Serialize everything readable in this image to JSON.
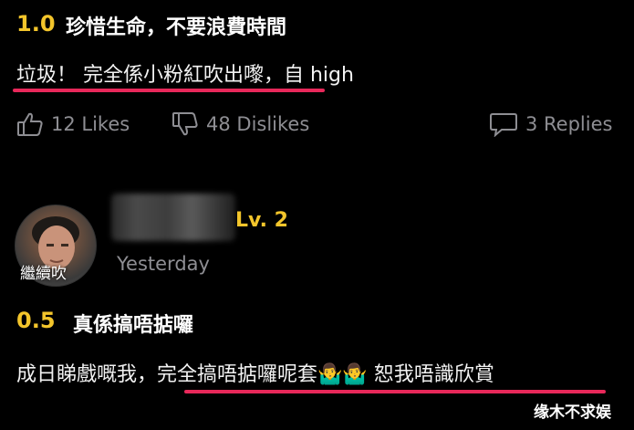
{
  "review1": {
    "score": "1.0",
    "title": "珍惜生命，不要浪費時間",
    "body_part1": "垃圾！ 完全係小粉紅吹出嚟",
    "body_part2": "，自 high",
    "likes": "12 Likes",
    "dislikes": "48 Dislikes",
    "replies": "3 Replies"
  },
  "review2": {
    "avatar_caption": "繼續吹",
    "level": "Lv. 2",
    "time": "Yesterday",
    "score": "0.5",
    "title": "真係搞唔掂囉",
    "body_part1": "成日睇戲嘅我，",
    "body_part2": "完全搞唔掂囉呢套",
    "emoji": "🤷‍♂️🤷‍♂️",
    "body_part3": " 恕我唔識欣賞"
  },
  "watermark": "缘木不求娱",
  "colors": {
    "accent_yellow": "#f3c52b",
    "underline_pink": "#e8285a",
    "muted_gray": "#8e8e93"
  },
  "icons": [
    "thumbs-up-icon",
    "thumbs-down-icon",
    "comment-bubble-icon"
  ]
}
